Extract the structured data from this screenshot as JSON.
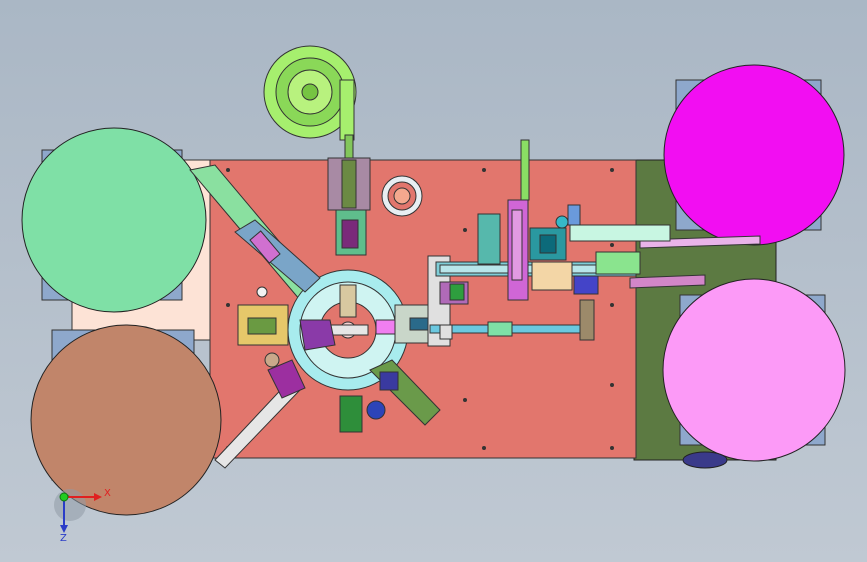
{
  "triad": {
    "x_label": "X",
    "z_label": "Z",
    "x_color": "#e02020",
    "z_color": "#2a3cc8",
    "origin_color": "#22cc22"
  },
  "colors": {
    "viewport_bg": "#b1bcc8",
    "base_plate": "#e2766d",
    "left_panel": "#fde3d6",
    "right_panel": "#5c7a42",
    "reel_green": "#7fe0a6",
    "reel_brown": "#c1856a",
    "reel_magenta": "#f20ef2",
    "reel_pink": "#fc9af7",
    "feeder_bowl": "#a6ef6e",
    "dial_table": "#a8ecee",
    "reel_mount": "#8ea8cc"
  }
}
